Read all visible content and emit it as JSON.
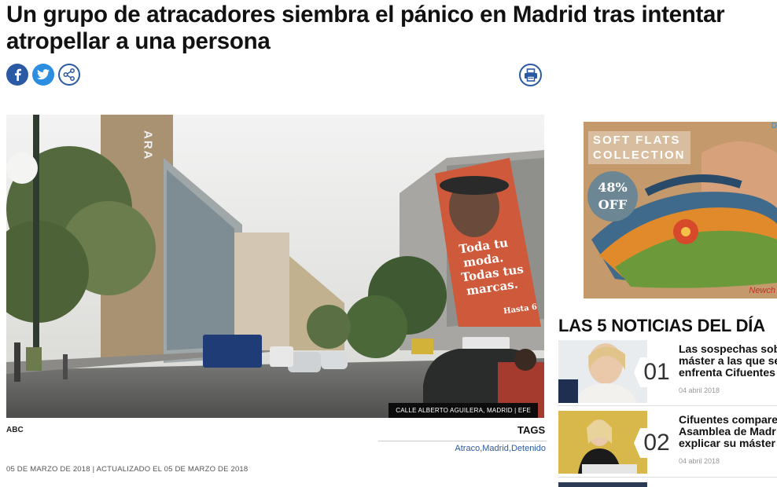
{
  "article": {
    "headline": "Un grupo de atracadores siembra el pánico en Madrid tras intentar atropellar a una persona",
    "photo_caption": "CALLE ALBERTO AGUILERA, MADRID | EFE",
    "source": "ABC",
    "dateline": "05 DE MARZO DE 2018 | ACTUALIZADO EL 05 DE MARZO DE 2018",
    "photo_sign_text": "ARA",
    "billboard_text": [
      "Toda tu",
      "moda.",
      "Todas tus",
      "marcas.",
      "Hasta 6"
    ]
  },
  "share": {
    "icons": [
      "facebook-icon",
      "twitter-icon",
      "share-icon",
      "print-icon"
    ]
  },
  "tags": {
    "title": "TAGS",
    "items": [
      "Atraco",
      "Madrid",
      "Detenido"
    ],
    "separator": ", "
  },
  "ad": {
    "title_line1": "SOFT FLATS",
    "title_line2": "COLLECTION",
    "discount": "48%",
    "discount_label": "OFF",
    "brand": "Newch",
    "choice": "D"
  },
  "top5": {
    "title": "LAS 5 NOTICIAS DEL DÍA",
    "items": [
      {
        "num": "01",
        "title_lines": [
          "Las sospechas sobr",
          "máster a las que se",
          "enfrenta Cifuentes"
        ],
        "date": "04 abril 2018"
      },
      {
        "num": "02",
        "title_lines": [
          "Cifuentes compare",
          "Asamblea de Madr",
          "explicar su máster"
        ],
        "date": "04 abril 2018"
      }
    ]
  },
  "colors": {
    "brand_blue": "#2b5aa4",
    "twitter_blue": "#2b8ee0",
    "tag_link": "#2b5aa4"
  }
}
